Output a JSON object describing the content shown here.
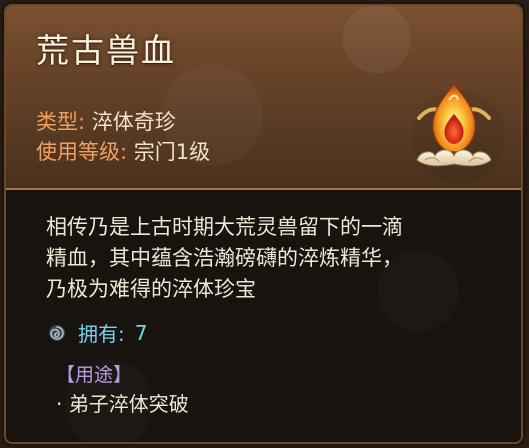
{
  "item": {
    "name": "荒古兽血",
    "type_label": "类型:",
    "type_value": "淬体奇珍",
    "level_label": "使用等级:",
    "level_value": "宗门1级",
    "icon": "flame-blood-icon"
  },
  "description": {
    "line1": "相传乃是上古时期大荒灵兽留下的一滴",
    "line2": "精血，其中蕴含浩瀚磅礴的淬炼精华，",
    "line3": "乃极为难得的淬体珍宝"
  },
  "owned": {
    "label": "拥有:",
    "count": "7",
    "icon": "swirl-icon"
  },
  "usage": {
    "title": "【用途】",
    "items": [
      "· 弟子淬体突破"
    ]
  },
  "colors": {
    "header_bg": "#6a4529",
    "label_orange": "#f0a060",
    "owned_blue": "#7ad0ee",
    "usage_purple": "#b79be6"
  }
}
